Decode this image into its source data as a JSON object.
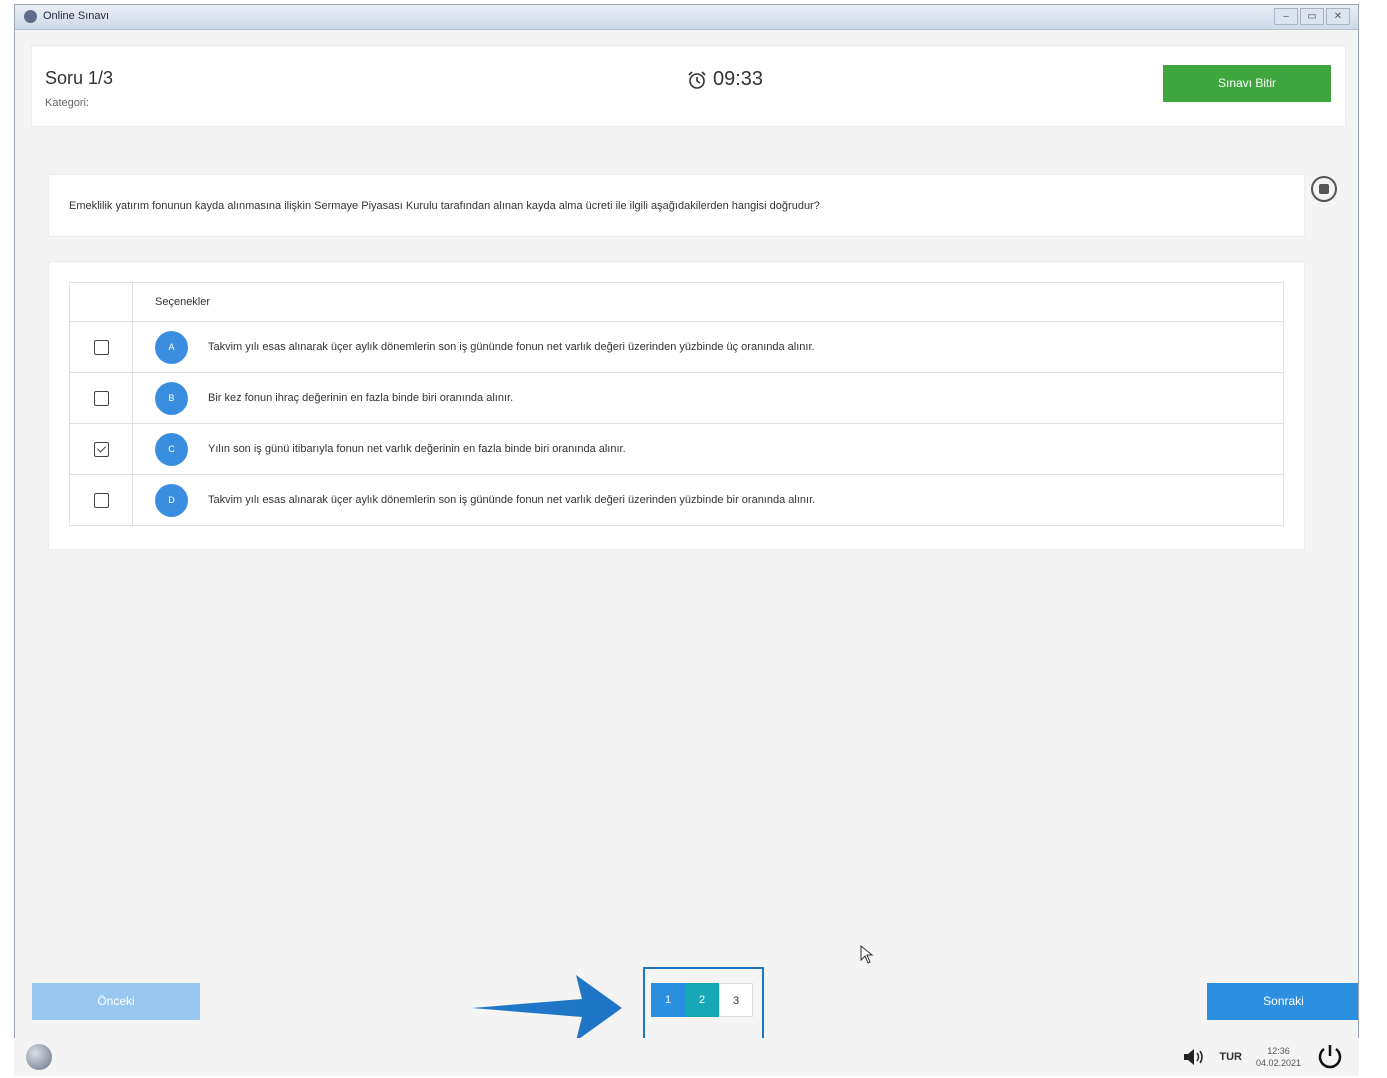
{
  "window": {
    "title": "Online Sınavı",
    "controls": [
      "–",
      "▭",
      "✕"
    ]
  },
  "header": {
    "question_number": "Soru 1/3",
    "category_label": "Kategori:",
    "timer": "09:33",
    "finish_button": "Sınavı Bitir"
  },
  "question": {
    "text": "Emeklilik yatırım fonunun kayda alınmasına ilişkin Sermaye Piyasası Kurulu tarafından alınan kayda alma ücreti ile ilgili aşağıdakilerden hangisi doğrudur?"
  },
  "options": {
    "header": "Seçenekler",
    "items": [
      {
        "letter": "A",
        "text": "Takvim yılı esas alınarak üçer aylık dönemlerin son iş gününde fonun net varlık değeri üzerinden yüzbinde üç oranında alınır.",
        "checked": false
      },
      {
        "letter": "B",
        "text": "Bir kez fonun ihraç değerinin en fazla binde biri oranında alınır.",
        "checked": false
      },
      {
        "letter": "C",
        "text": "Yılın son iş günü itibarıyla fonun net varlık değerinin en fazla binde biri oranında alınır.",
        "checked": true
      },
      {
        "letter": "D",
        "text": "Takvim yılı esas alınarak üçer aylık dönemlerin son iş gününde fonun net varlık değeri üzerinden yüzbinde bir oranında alınır.",
        "checked": false
      }
    ]
  },
  "navigation": {
    "prev_label": "Önceki",
    "next_label": "Sonraki",
    "pages": [
      "1",
      "2",
      "3"
    ]
  },
  "taskbar": {
    "language": "TUR",
    "time": "12:36",
    "date": "04.02.2021"
  },
  "colors": {
    "finish": "#3fa63f",
    "option_letter": "#3a8ee0",
    "next": "#2c8fe0",
    "prev": "#98c8f0",
    "page_answered": "#17a8b8",
    "highlight": "#1f76c6"
  }
}
